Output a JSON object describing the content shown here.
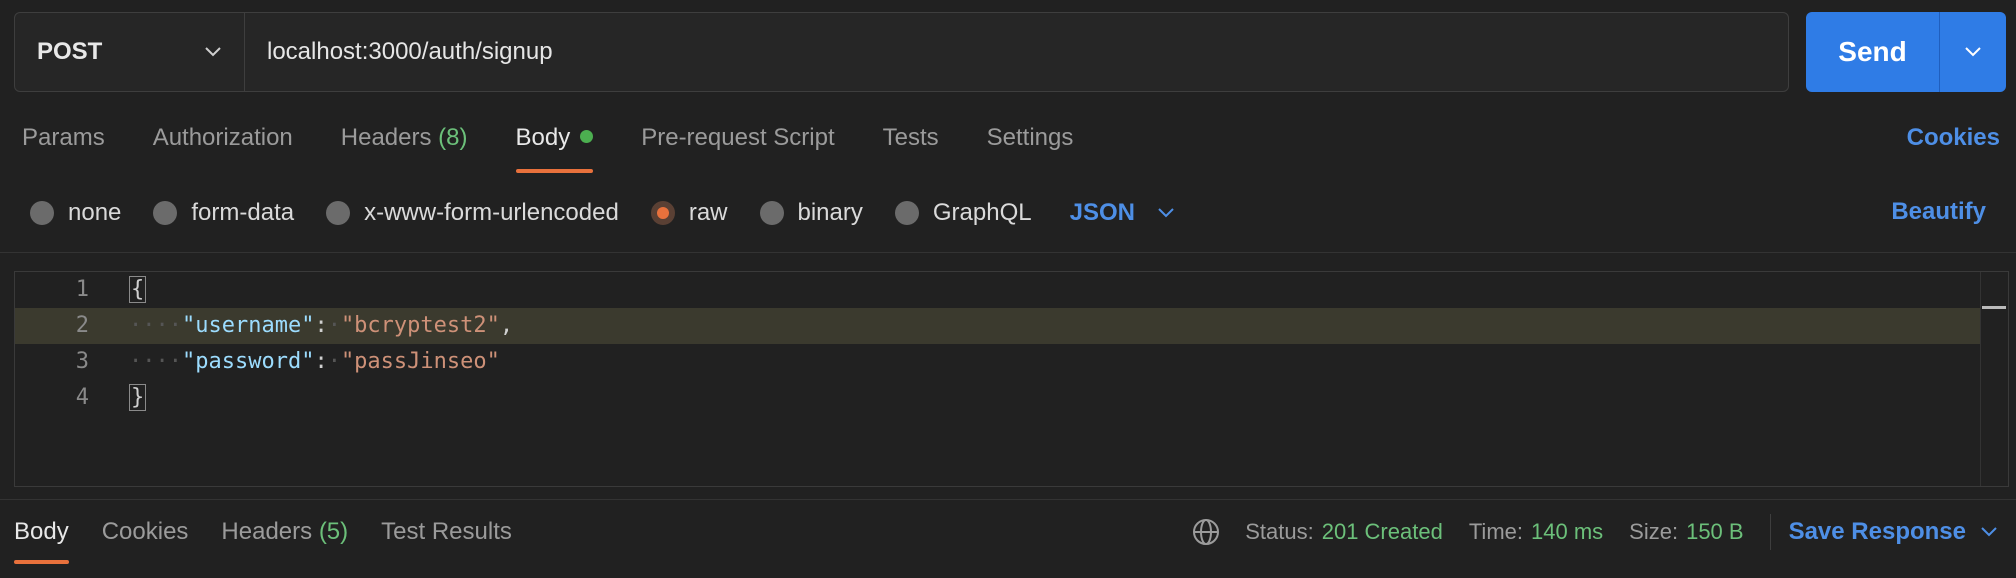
{
  "request": {
    "method": "POST",
    "url": "localhost:3000/auth/signup",
    "send_label": "Send"
  },
  "request_tabs": [
    {
      "label": "Params"
    },
    {
      "label": "Authorization"
    },
    {
      "label": "Headers",
      "count": "(8)"
    },
    {
      "label": "Body"
    },
    {
      "label": "Pre-request Script"
    },
    {
      "label": "Tests"
    },
    {
      "label": "Settings"
    }
  ],
  "cookies_label": "Cookies",
  "body_types": [
    {
      "label": "none"
    },
    {
      "label": "form-data"
    },
    {
      "label": "x-www-form-urlencoded"
    },
    {
      "label": "raw",
      "checked": true
    },
    {
      "label": "binary"
    },
    {
      "label": "GraphQL"
    }
  ],
  "format_label": "JSON",
  "beautify_label": "Beautify",
  "editor": {
    "lines": [
      {
        "num": "1",
        "open": "{"
      },
      {
        "num": "2",
        "indent": "····",
        "key": "\"username\"",
        "colon": ":",
        "sp": "·",
        "value": "\"bcryptest2\"",
        "comma": ","
      },
      {
        "num": "3",
        "indent": "····",
        "key": "\"password\"",
        "colon": ":",
        "sp": "·",
        "value": "\"passJinseo\""
      },
      {
        "num": "4",
        "close": "}"
      }
    ]
  },
  "response_tabs": [
    {
      "label": "Body"
    },
    {
      "label": "Cookies"
    },
    {
      "label": "Headers",
      "count": "(5)"
    },
    {
      "label": "Test Results"
    }
  ],
  "response_status": {
    "status_label": "Status:",
    "status_value": "201 Created",
    "time_label": "Time:",
    "time_value": "140 ms",
    "size_label": "Size:",
    "size_value": "150 B"
  },
  "save_response_label": "Save Response",
  "colors": {
    "accent": "#2f7ce6",
    "link": "#4e8fe6",
    "active_underline": "#e8713c",
    "success": "#6cc07a"
  }
}
